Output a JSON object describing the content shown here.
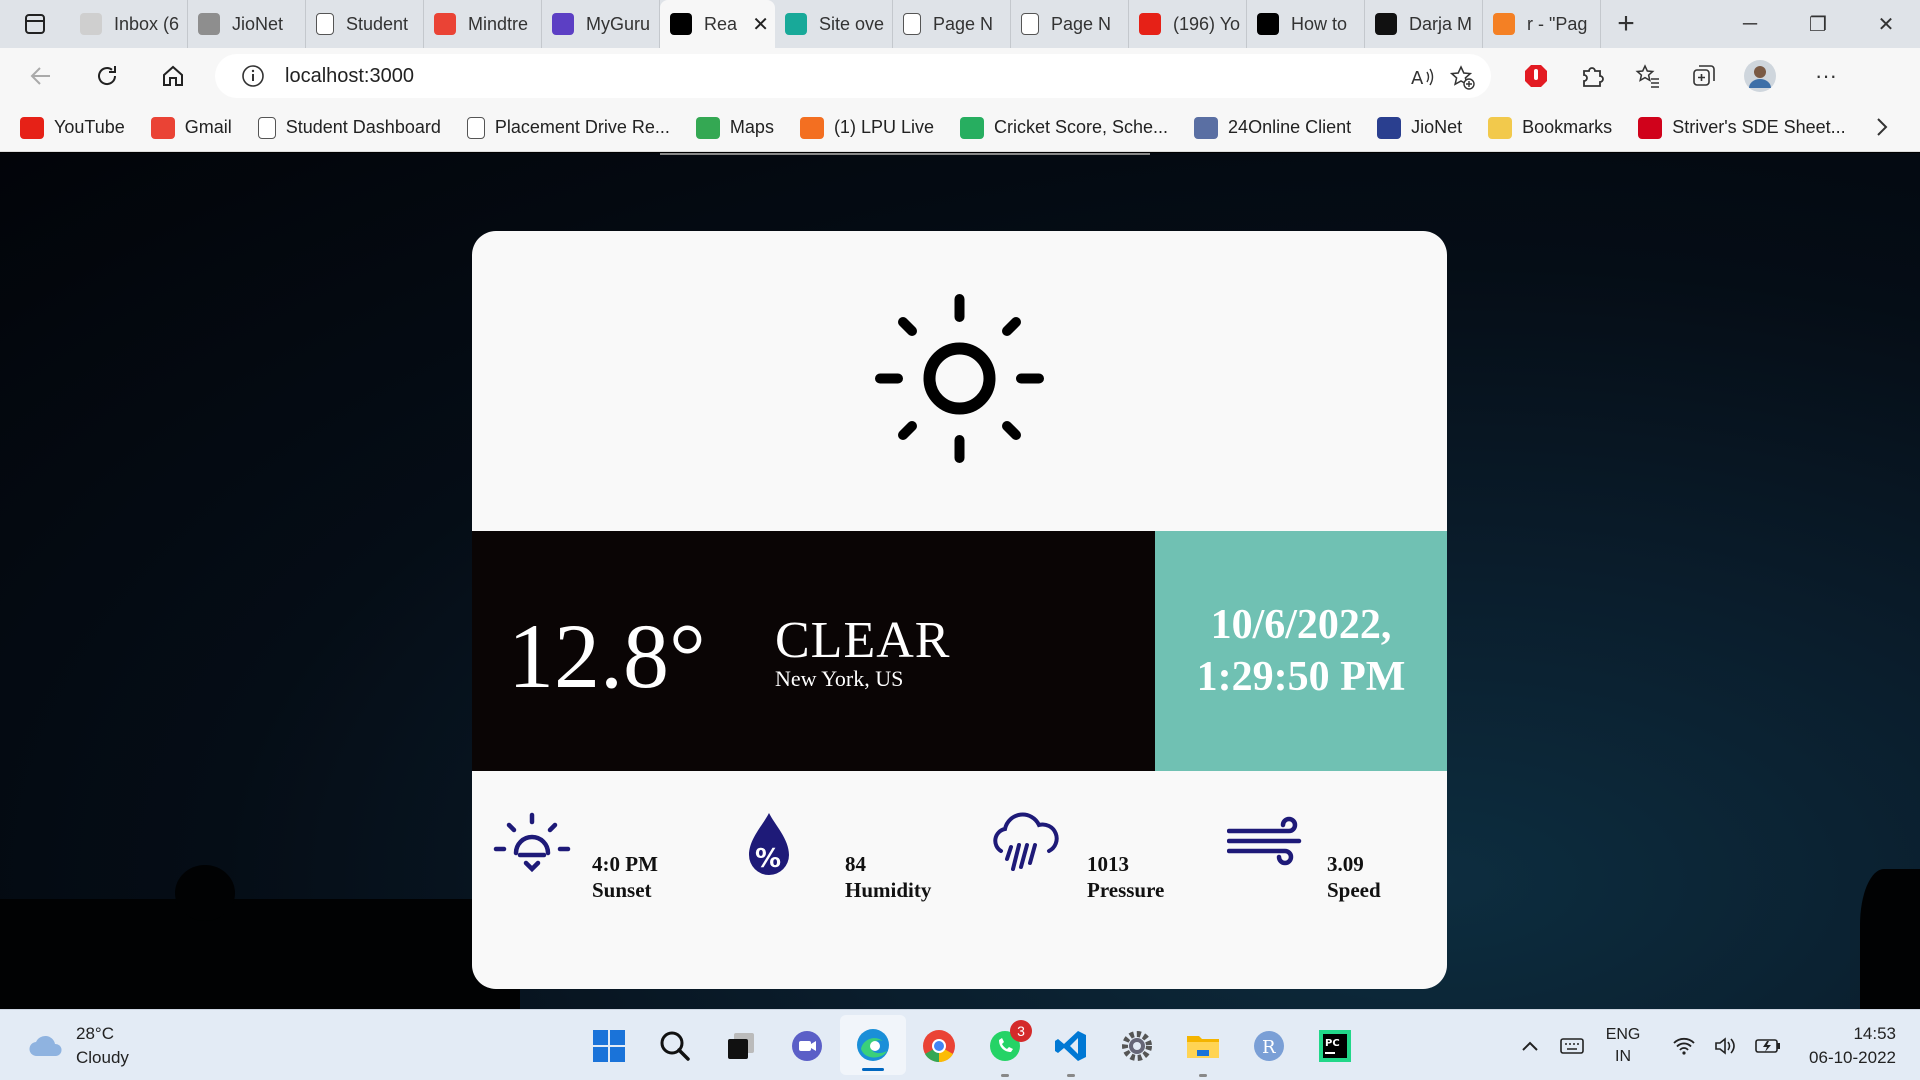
{
  "browser": {
    "tabs": [
      {
        "label": "Inbox (6",
        "icon": "gmail-icon",
        "color": "#cfcfcf"
      },
      {
        "label": "JioNet",
        "icon": "jio-icon",
        "color": "#8e8e8e"
      },
      {
        "label": "Student",
        "icon": "page-icon",
        "color": "#ffffff"
      },
      {
        "label": "Mindtre",
        "icon": "gmail-icon",
        "color": "#ea4335"
      },
      {
        "label": "MyGuru",
        "icon": "list-icon",
        "color": "#5c3fc4"
      },
      {
        "label": "Rea",
        "icon": "react-icon",
        "color": "#000000",
        "active": true
      },
      {
        "label": "Site ove",
        "icon": "diamond-icon",
        "color": "#18a999"
      },
      {
        "label": "Page N",
        "icon": "page-icon",
        "color": "#ffffff"
      },
      {
        "label": "Page N",
        "icon": "page-icon",
        "color": "#ffffff"
      },
      {
        "label": "(196) Yo",
        "icon": "youtube-icon",
        "color": "#e62117"
      },
      {
        "label": "How to",
        "icon": "codeforces-icon",
        "color": "#000000"
      },
      {
        "label": "Darja M",
        "icon": "ib-icon",
        "color": "#111111"
      },
      {
        "label": "r - \"Pag",
        "icon": "stackoverflow-icon",
        "color": "#f48024"
      }
    ],
    "url": "localhost:3000",
    "bookmarks": [
      {
        "label": "YouTube",
        "icon": "youtube-icon",
        "color": "#e62117"
      },
      {
        "label": "Gmail",
        "icon": "gmail-icon",
        "color": "#ea4335"
      },
      {
        "label": "Student Dashboard",
        "icon": "page-icon",
        "color": "#ffffff"
      },
      {
        "label": "Placement Drive Re...",
        "icon": "page-icon",
        "color": "#ffffff"
      },
      {
        "label": "Maps",
        "icon": "maps-icon",
        "color": "#34a853"
      },
      {
        "label": "(1) LPU Live",
        "icon": "lpu-icon",
        "color": "#f36f21"
      },
      {
        "label": "Cricket Score, Sche...",
        "icon": "cricbuzz-icon",
        "color": "#27ae60"
      },
      {
        "label": "24Online Client",
        "icon": "cloud-icon",
        "color": "#5a6fa3"
      },
      {
        "label": "JioNet",
        "icon": "jio-icon",
        "color": "#2a3f8f"
      },
      {
        "label": "Bookmarks",
        "icon": "folder-icon",
        "color": "#f2c94c"
      },
      {
        "label": "Striver's SDE Sheet...",
        "icon": "tuf-icon",
        "color": "#d0021b"
      }
    ]
  },
  "weather": {
    "temperature": "12.8°",
    "condition": "CLEAR",
    "location": "New York, US",
    "date": "10/6/2022,",
    "time": "1:29:50 PM",
    "accent_color": "#70c1b3",
    "icon_color": "#1e1a78",
    "stats": [
      {
        "value": "4:0 PM",
        "label": "Sunset",
        "icon": "sunset-icon"
      },
      {
        "value": "84",
        "label": "Humidity",
        "icon": "humidity-icon"
      },
      {
        "value": "1013",
        "label": "Pressure",
        "icon": "pressure-icon"
      },
      {
        "value": "3.09",
        "label": "Speed",
        "icon": "wind-icon"
      }
    ]
  },
  "taskbar": {
    "weather_temp": "28°C",
    "weather_desc": "Cloudy",
    "whatsapp_badge": "3",
    "lang_1": "ENG",
    "lang_2": "IN",
    "clock_time": "14:53",
    "clock_date": "06-10-2022"
  }
}
